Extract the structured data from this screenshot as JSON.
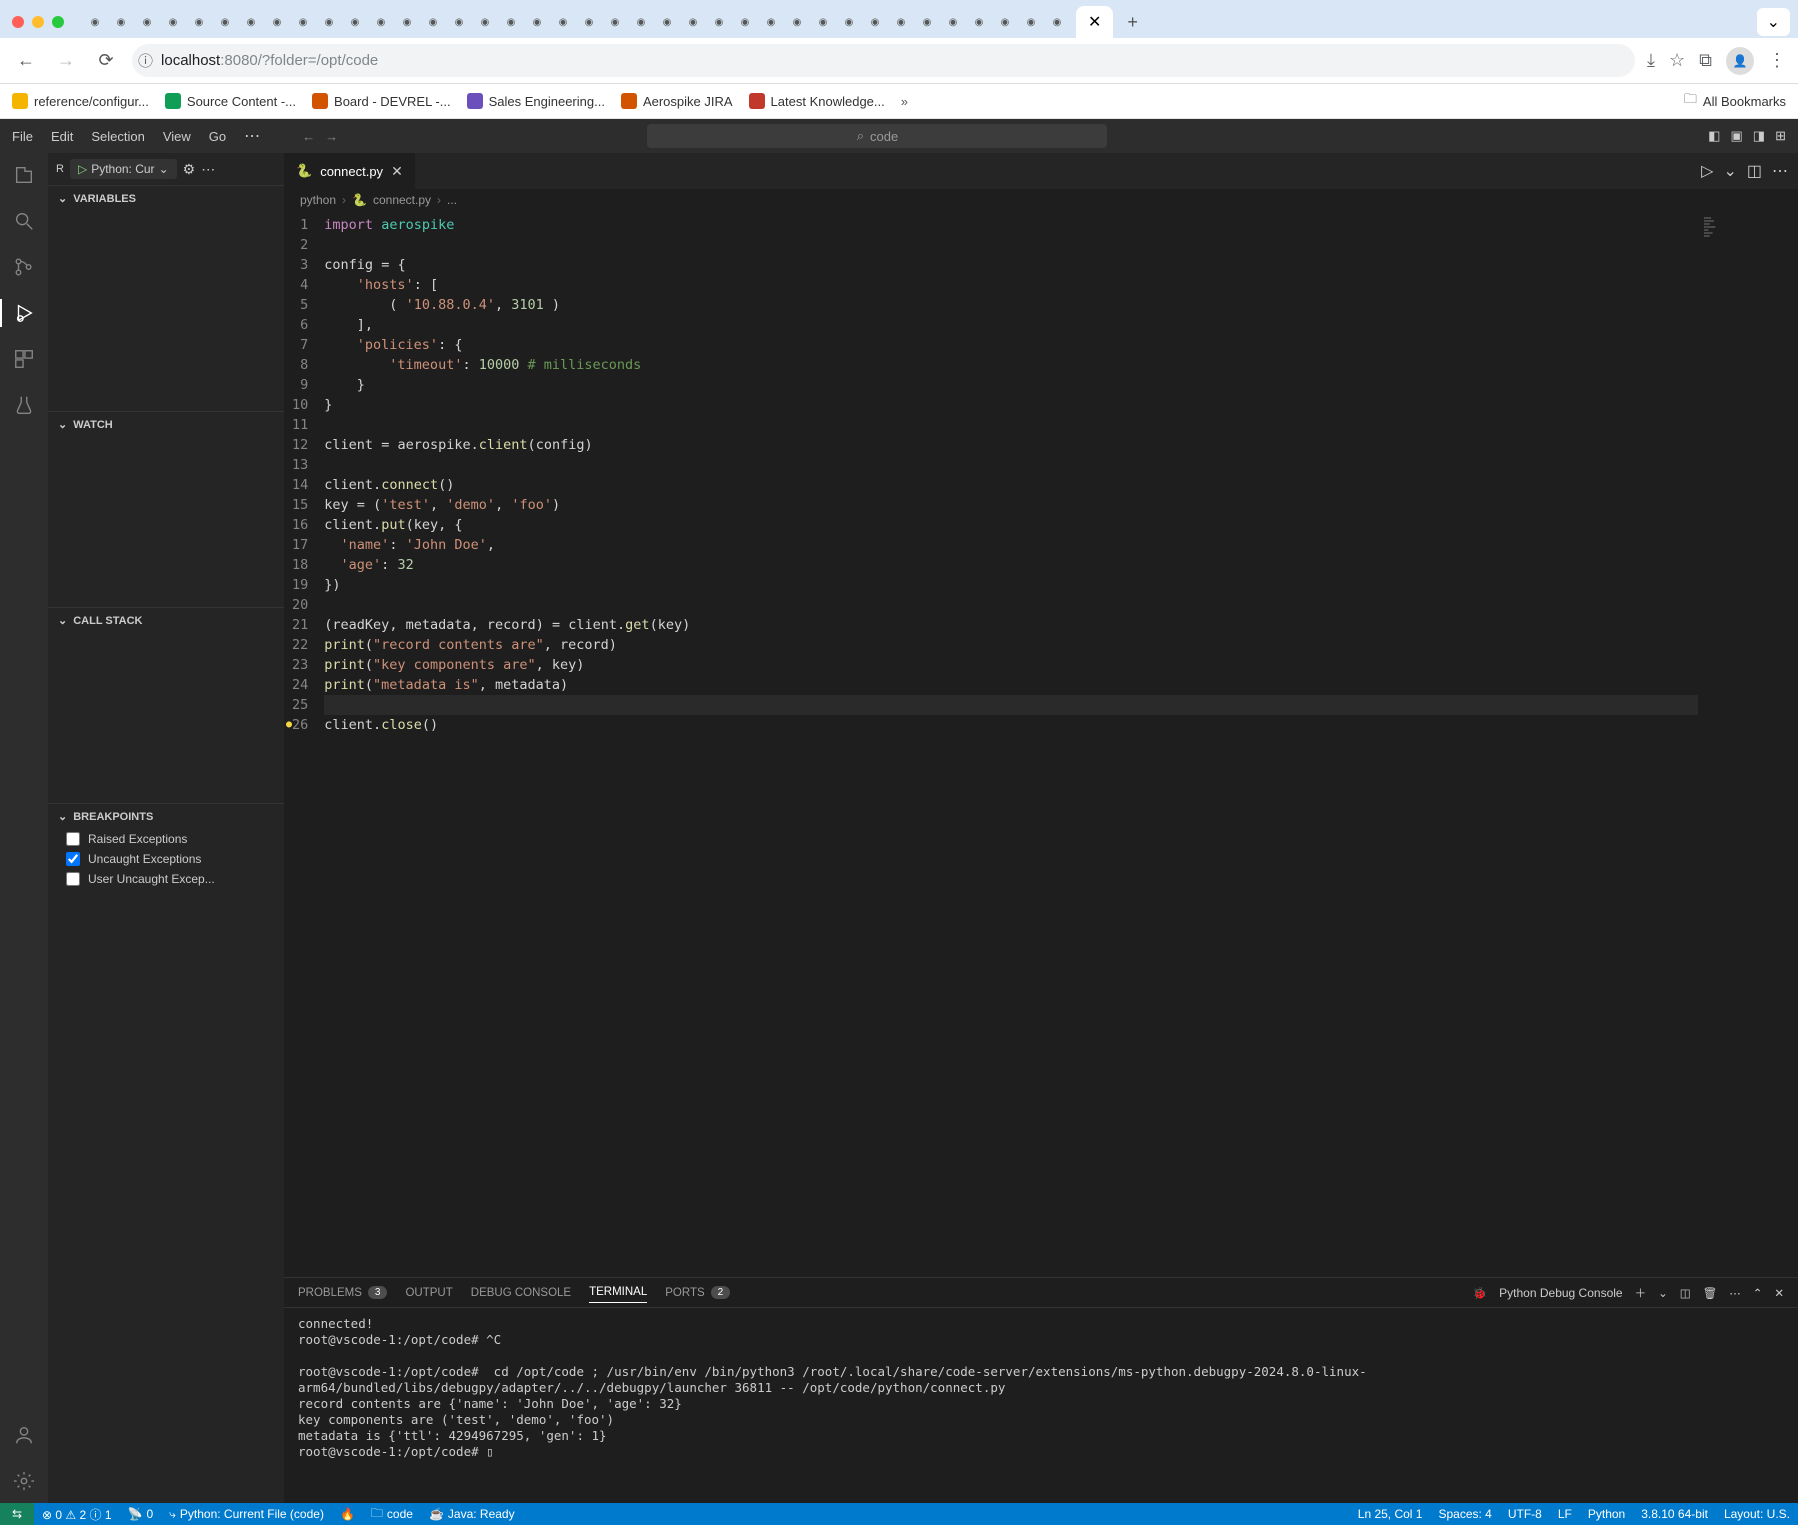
{
  "browser": {
    "url_prefix": "localhost",
    "url_suffix": ":8080/?folder=/opt/code",
    "close_marker": "✕",
    "plus": "+"
  },
  "bookmarks": [
    {
      "label": "reference/configur...",
      "color": "#f5b400"
    },
    {
      "label": "Source Content -...",
      "color": "#0f9d58"
    },
    {
      "label": "Board - DEVREL -...",
      "color": "#d35400"
    },
    {
      "label": "Sales Engineering...",
      "color": "#6b4fbb"
    },
    {
      "label": "Aerospike JIRA",
      "color": "#d35400"
    },
    {
      "label": "Latest Knowledge...",
      "color": "#c0392b"
    }
  ],
  "all_bookmarks": "All Bookmarks",
  "menubar": [
    "File",
    "Edit",
    "Selection",
    "View",
    "Go"
  ],
  "search_placeholder": "code",
  "run_config": {
    "prefix": "R",
    "label": "Python: Cur"
  },
  "sidebar_sections": {
    "variables": "VARIABLES",
    "watch": "WATCH",
    "call_stack": "CALL STACK",
    "breakpoints": "BREAKPOINTS"
  },
  "breakpoints": [
    {
      "label": "Raised Exceptions",
      "checked": false
    },
    {
      "label": "Uncaught Exceptions",
      "checked": true
    },
    {
      "label": "User Uncaught Excep...",
      "checked": false
    }
  ],
  "editor_tab": "connect.py",
  "breadcrumbs": {
    "folder": "python",
    "file": "connect.py",
    "tail": "..."
  },
  "code_lines": [
    {
      "n": 1,
      "html": "<span class='tok-kw'>import</span> <span class='tok-mod'>aerospike</span>"
    },
    {
      "n": 2,
      "html": ""
    },
    {
      "n": 3,
      "html": "<span class='tok-id'>config</span> <span class='tok-punc'>=</span> <span class='tok-punc'>{</span>"
    },
    {
      "n": 4,
      "html": "    <span class='tok-str'>'hosts'</span><span class='tok-punc'>:</span> <span class='tok-punc'>[</span>"
    },
    {
      "n": 5,
      "html": "        <span class='tok-punc'>(</span> <span class='tok-str'>'10.88.0.4'</span><span class='tok-punc'>,</span> <span class='tok-num'>3101</span> <span class='tok-punc'>)</span>"
    },
    {
      "n": 6,
      "html": "    <span class='tok-punc'>],</span>"
    },
    {
      "n": 7,
      "html": "    <span class='tok-str'>'policies'</span><span class='tok-punc'>:</span> <span class='tok-punc'>{</span>"
    },
    {
      "n": 8,
      "html": "        <span class='tok-str'>'timeout'</span><span class='tok-punc'>:</span> <span class='tok-num'>10000</span> <span class='tok-comment'># milliseconds</span>"
    },
    {
      "n": 9,
      "html": "    <span class='tok-punc'>}</span>"
    },
    {
      "n": 10,
      "html": "<span class='tok-punc'>}</span>"
    },
    {
      "n": 11,
      "html": ""
    },
    {
      "n": 12,
      "html": "<span class='tok-id'>client</span> <span class='tok-punc'>=</span> <span class='tok-id'>aerospike</span><span class='tok-punc'>.</span><span class='tok-func'>client</span><span class='tok-punc'>(</span><span class='tok-id'>config</span><span class='tok-punc'>)</span>"
    },
    {
      "n": 13,
      "html": ""
    },
    {
      "n": 14,
      "html": "<span class='tok-id'>client</span><span class='tok-punc'>.</span><span class='tok-func'>connect</span><span class='tok-punc'>()</span>"
    },
    {
      "n": 15,
      "html": "<span class='tok-id'>key</span> <span class='tok-punc'>=</span> <span class='tok-punc'>(</span><span class='tok-str'>'test'</span><span class='tok-punc'>,</span> <span class='tok-str'>'demo'</span><span class='tok-punc'>,</span> <span class='tok-str'>'foo'</span><span class='tok-punc'>)</span>"
    },
    {
      "n": 16,
      "html": "<span class='tok-id'>client</span><span class='tok-punc'>.</span><span class='tok-func'>put</span><span class='tok-punc'>(</span><span class='tok-id'>key</span><span class='tok-punc'>,</span> <span class='tok-punc'>{</span>"
    },
    {
      "n": 17,
      "html": "  <span class='tok-str'>'name'</span><span class='tok-punc'>:</span> <span class='tok-str'>'John Doe'</span><span class='tok-punc'>,</span>"
    },
    {
      "n": 18,
      "html": "  <span class='tok-str'>'age'</span><span class='tok-punc'>:</span> <span class='tok-num'>32</span>"
    },
    {
      "n": 19,
      "html": "<span class='tok-punc'>})</span>"
    },
    {
      "n": 20,
      "html": ""
    },
    {
      "n": 21,
      "html": "<span class='tok-punc'>(</span><span class='tok-id'>readKey</span><span class='tok-punc'>,</span> <span class='tok-id'>metadata</span><span class='tok-punc'>,</span> <span class='tok-id'>record</span><span class='tok-punc'>)</span> <span class='tok-punc'>=</span> <span class='tok-id'>client</span><span class='tok-punc'>.</span><span class='tok-func'>get</span><span class='tok-punc'>(</span><span class='tok-id'>key</span><span class='tok-punc'>)</span>"
    },
    {
      "n": 22,
      "html": "<span class='tok-func'>print</span><span class='tok-punc'>(</span><span class='tok-str'>\"record contents are\"</span><span class='tok-punc'>,</span> <span class='tok-id'>record</span><span class='tok-punc'>)</span>"
    },
    {
      "n": 23,
      "html": "<span class='tok-func'>print</span><span class='tok-punc'>(</span><span class='tok-str'>\"key components are\"</span><span class='tok-punc'>,</span> <span class='tok-id'>key</span><span class='tok-punc'>)</span>"
    },
    {
      "n": 24,
      "html": "<span class='tok-func'>print</span><span class='tok-punc'>(</span><span class='tok-str'>\"metadata is\"</span><span class='tok-punc'>,</span> <span class='tok-id'>metadata</span><span class='tok-punc'>)</span>"
    },
    {
      "n": 25,
      "html": "",
      "current": true
    },
    {
      "n": 26,
      "html": "<span class='tok-id'>client</span><span class='tok-punc'>.</span><span class='tok-func'>close</span><span class='tok-punc'>()</span>",
      "bp": true
    }
  ],
  "panel": {
    "problems": "PROBLEMS",
    "problems_count": "3",
    "output": "OUTPUT",
    "debug_console": "DEBUG CONSOLE",
    "terminal": "TERMINAL",
    "ports": "PORTS",
    "ports_count": "2",
    "terminal_name": "Python Debug Console"
  },
  "terminal_output": "connected!\nroot@vscode-1:/opt/code# ^C\n\nroot@vscode-1:/opt/code#  cd /opt/code ; /usr/bin/env /bin/python3 /root/.local/share/code-server/extensions/ms-python.debugpy-2024.8.0-linux-arm64/bundled/libs/debugpy/adapter/../../debugpy/launcher 36811 -- /opt/code/python/connect.py \nrecord contents are {'name': 'John Doe', 'age': 32}\nkey components are ('test', 'demo', 'foo')\nmetadata is {'ttl': 4294967295, 'gen': 1}\nroot@vscode-1:/opt/code# ▯",
  "statusbar": {
    "errors": "⊗ 0 ⚠ 2 ⓘ 1",
    "radio": "0",
    "debug_target": "Python: Current File (code)",
    "code": "code",
    "java": "Java: Ready",
    "ln_col": "Ln 25, Col 1",
    "spaces": "Spaces: 4",
    "encoding": "UTF-8",
    "eol": "LF",
    "lang": "Python",
    "python_version": "3.8.10 64-bit",
    "layout": "Layout: U.S."
  }
}
